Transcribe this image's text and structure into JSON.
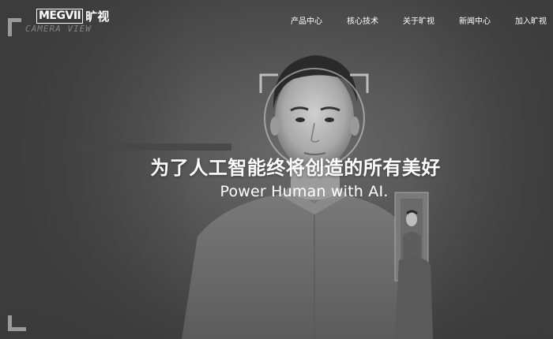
{
  "header": {
    "logo_text": "MEGVII",
    "logo_cn": "旷视",
    "brand_sub": "CAMERA VIEW",
    "nav": [
      {
        "label": "产品中心"
      },
      {
        "label": "核心技术"
      },
      {
        "label": "关于旷视"
      },
      {
        "label": "新闻中心"
      },
      {
        "label": "加入旷视"
      }
    ]
  },
  "hero": {
    "headline": "为了人工智能终将创造的所有美好",
    "subline": "Power Human with AI."
  },
  "colors": {
    "background": "#3a3a3a",
    "text": "#ffffff",
    "frame": "#bdbdbd"
  }
}
